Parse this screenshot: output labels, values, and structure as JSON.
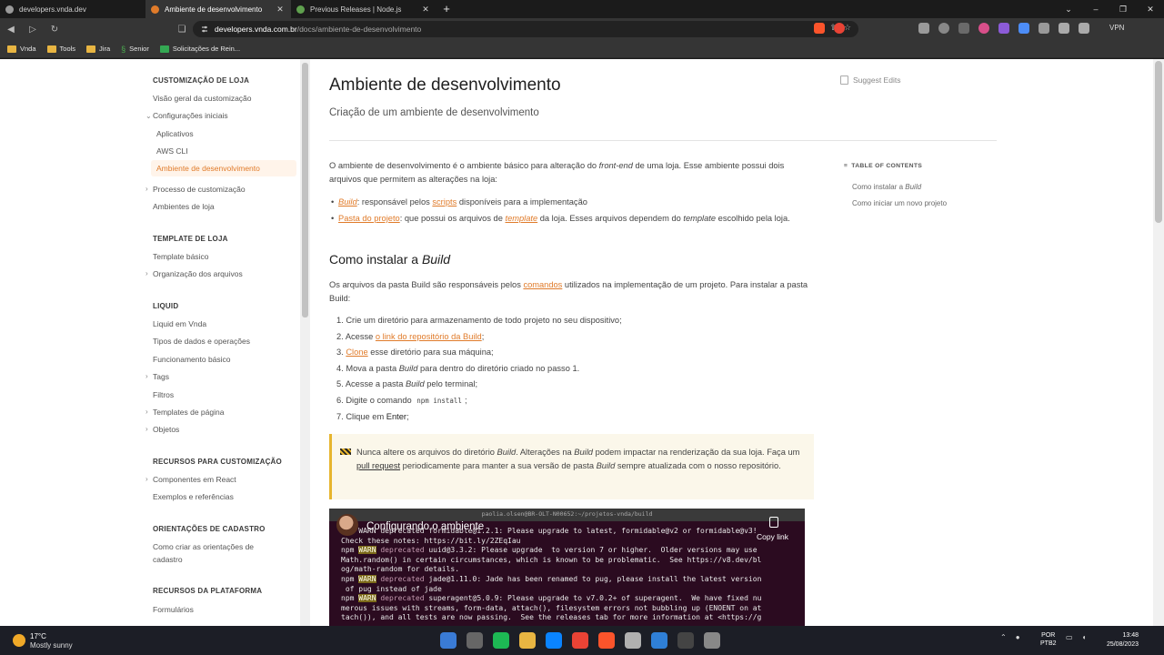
{
  "browser": {
    "tabs": [
      {
        "label": "developers.vnda.dev",
        "color": "#9a9a9a"
      },
      {
        "label": "Ambiente de desenvolvimento",
        "color": "#e07b2a"
      },
      {
        "label": "Previous Releases | Node.js",
        "color": "#5fa04e"
      }
    ],
    "new_tab": "+",
    "url_host": "developers.vnda.com.br",
    "url_path": "/docs/ambiente-de-desenvolvimento",
    "vpn": "VPN",
    "bookmarks": [
      "Vnda",
      "Tools",
      "Jira",
      "Senior",
      "Solicitações de Rein..."
    ]
  },
  "sidebar": {
    "sections": [
      {
        "heading": "CUSTOMIZAÇÃO DE LOJA"
      },
      {
        "heading": "TEMPLATE DE LOJA"
      },
      {
        "heading": "LIQUID"
      },
      {
        "heading": "RECURSOS PARA CUSTOMIZAÇÃO"
      },
      {
        "heading": "ORIENTAÇÕES DE CADASTRO"
      },
      {
        "heading": "RECURSOS DA PLATAFORMA"
      }
    ],
    "items": {
      "visao_geral": "Visão geral da customização",
      "configuracoes": "Configurações iniciais",
      "aplicativos": "Aplicativos",
      "aws_cli": "AWS CLI",
      "ambiente": "Ambiente de desenvolvimento",
      "processo": "Processo de customização",
      "ambientes_loja": "Ambientes de loja",
      "template_basico": "Template básico",
      "organizacao": "Organização dos arquivos",
      "liquid_vnda": "Liquid em Vnda",
      "tipos_dados": "Tipos de dados e operações",
      "funcionamento": "Funcionamento básico",
      "tags": "Tags",
      "filtros": "Filtros",
      "templates_pagina": "Templates de página",
      "objetos": "Objetos",
      "componentes_react": "Componentes em React",
      "exemplos": "Exemplos e referências",
      "orientacoes_1": "Como criar as orientações de",
      "orientacoes_2": "cadastro",
      "formularios": "Formulários"
    }
  },
  "article": {
    "title": "Ambiente de desenvolvimento",
    "subtitle": "Criação de um ambiente de desenvolvimento",
    "intro_1": "O ambiente de desenvolvimento é o ambiente básico para alteração do ",
    "intro_em": "front-end",
    "intro_2": " de uma loja. Esse ambiente possui dois arquivos que permitem as alterações na loja:",
    "b1_link": "Build",
    "b1_text": ": responsável pelos ",
    "b1_link2": "scripts",
    "b1_text2": " disponíveis para a implementação",
    "b2_link": "Pasta do projeto",
    "b2_text": ": que possui os arquivos de ",
    "b2_link2": "template",
    "b2_text2": " da loja. Esses arquivos dependem do ",
    "b2_em": "template",
    "b2_text3": " escolhido pela loja.",
    "h2_text": "Como instalar a ",
    "h2_em": "Build",
    "p2_1": "Os arquivos da pasta Build são responsáveis pelos ",
    "p2_link": "comandos",
    "p2_2": " utilizados na implementação de um projeto. Para instalar a pasta Build:",
    "s1": "1. Crie um diretório para armazenamento de todo projeto no seu dispositivo;",
    "s2a": "2. Acesse ",
    "s2link": "o link do repositório da Build",
    "s2b": ";",
    "s3link": "Clone",
    "s3a": "3. ",
    "s3b": " esse diretório para sua máquina;",
    "s4a": "4. Mova a pasta ",
    "s4em": "Build",
    "s4b": " para dentro do diretório criado no passo 1.",
    "s5a": "5. Acesse a pasta ",
    "s5em": "Build",
    "s5b": " pelo terminal;",
    "s6a": "6. Digite o comando ",
    "s6code": "npm install",
    "s6b": ";",
    "s7a": "7. Clique em ",
    "s7b": "Enter",
    "s7c": ";",
    "callout_1": "Nunca altere os arquivos do diretório ",
    "callout_em1": "Build",
    "callout_2": ". Alterações na ",
    "callout_em2": "Build",
    "callout_3": " podem impactar na renderização da sua loja. Faça um ",
    "callout_link": "pull request",
    "callout_4": " periodicamente para manter a sua versão de pasta ",
    "callout_em3": "Build",
    "callout_5": " sempre atualizada com o nosso repositório."
  },
  "video": {
    "title": "Configurando o ambiente",
    "copy_link": "Copy link",
    "window_title": "paolia.olsen@BR-OLT-N00652:~/projetos-vnda/build",
    "line1": "npm WARN deprecated formidable@1.2.1: Please upgrade to latest, formidable@v2 or formidable@v3!",
    "line2": "Check these notes: https://bit.ly/2ZEqIau",
    "line3_pre": "npm ",
    "warn": "WARN",
    "deprecated": " deprecated",
    "line3_post": " uuid@3.3.2: Please upgrade  to version 7 or higher.  Older versions may use",
    "line4": "Math.random() in certain circumstances, which is known to be problematic.  See https://v8.dev/bl",
    "line5": "og/math-random for details.",
    "line6_post": " jade@1.11.0: Jade has been renamed to pug, please install the latest version",
    "line7": " of pug instead of jade",
    "line8_post": " superagent@5.0.9: Please upgrade to v7.0.2+ of superagent.  We have fixed nu",
    "line9": "merous issues with streams, form-data, attach(), filesystem errors not bubbling up (ENOENT on at",
    "line10": "tach()), and all tests are now passing.  See the releases tab for more information at <https://g"
  },
  "right_panel": {
    "suggest_edits": "Suggest Edits",
    "toc_heading": "TABLE OF CONTENTS",
    "toc_1a": "Como instalar a ",
    "toc_1b": "Build",
    "toc_2": "Como iniciar um novo projeto"
  },
  "taskbar": {
    "temp": "17°C",
    "weather": "Mostly sunny",
    "lang_1": "POR",
    "lang_2": "PTB2",
    "time": "13:48",
    "date": "25/08/2023",
    "app_colors": [
      "#3a7bd5",
      "#666666",
      "#1db954",
      "#e8b542",
      "#0a84ff",
      "#e94335",
      "#fb542b",
      "#b0b0b0",
      "#2f7fd6",
      "#444444",
      "#888888"
    ]
  }
}
